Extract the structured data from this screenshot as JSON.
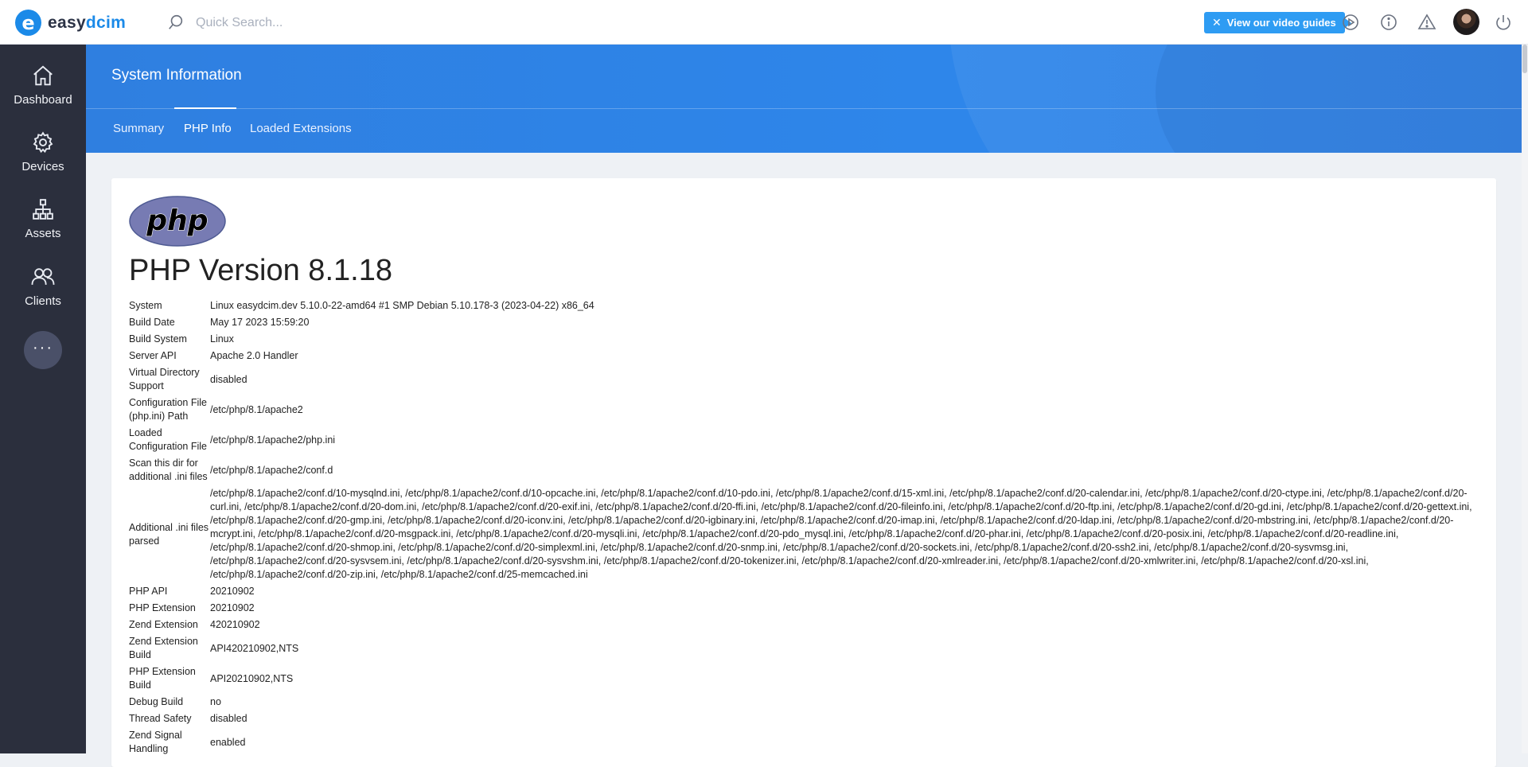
{
  "topbar": {
    "logo_letter": "e",
    "logo_text_a": "easy",
    "logo_text_b": "dcim",
    "search_placeholder": "Quick Search...",
    "video_button_label": "View our video guides",
    "icons": [
      "search-icon",
      "play-icon",
      "info-icon",
      "warning-icon",
      "avatar",
      "power-icon"
    ]
  },
  "sidebar": {
    "items": [
      {
        "label": "Dashboard",
        "icon": "home-icon"
      },
      {
        "label": "Devices",
        "icon": "gear-icon"
      },
      {
        "label": "Assets",
        "icon": "hierarchy-icon"
      },
      {
        "label": "Clients",
        "icon": "users-icon"
      }
    ],
    "more_label": "···"
  },
  "header": {
    "title": "System Information",
    "tabs": [
      {
        "label": "Summary",
        "active": false
      },
      {
        "label": "PHP Info",
        "active": true
      },
      {
        "label": "Loaded Extensions",
        "active": false
      }
    ]
  },
  "phpinfo": {
    "logo_text": "php",
    "version_title": "PHP Version 8.1.18",
    "rows": [
      {
        "key": "System",
        "value": "Linux easydcim.dev 5.10.0-22-amd64 #1 SMP Debian 5.10.178-3 (2023-04-22) x86_64"
      },
      {
        "key": "Build Date",
        "value": "May 17 2023 15:59:20"
      },
      {
        "key": "Build System",
        "value": "Linux"
      },
      {
        "key": "Server API",
        "value": "Apache 2.0 Handler"
      },
      {
        "key": "Virtual Directory Support",
        "value": "disabled"
      },
      {
        "key": "Configuration File (php.ini) Path",
        "value": "/etc/php/8.1/apache2"
      },
      {
        "key": "Loaded Configuration File",
        "value": "/etc/php/8.1/apache2/php.ini"
      },
      {
        "key": "Scan this dir for additional .ini files",
        "value": "/etc/php/8.1/apache2/conf.d"
      },
      {
        "key": "Additional .ini files parsed",
        "value": "/etc/php/8.1/apache2/conf.d/10-mysqlnd.ini, /etc/php/8.1/apache2/conf.d/10-opcache.ini, /etc/php/8.1/apache2/conf.d/10-pdo.ini, /etc/php/8.1/apache2/conf.d/15-xml.ini, /etc/php/8.1/apache2/conf.d/20-calendar.ini, /etc/php/8.1/apache2/conf.d/20-ctype.ini, /etc/php/8.1/apache2/conf.d/20-curl.ini, /etc/php/8.1/apache2/conf.d/20-dom.ini, /etc/php/8.1/apache2/conf.d/20-exif.ini, /etc/php/8.1/apache2/conf.d/20-ffi.ini, /etc/php/8.1/apache2/conf.d/20-fileinfo.ini, /etc/php/8.1/apache2/conf.d/20-ftp.ini, /etc/php/8.1/apache2/conf.d/20-gd.ini, /etc/php/8.1/apache2/conf.d/20-gettext.ini, /etc/php/8.1/apache2/conf.d/20-gmp.ini, /etc/php/8.1/apache2/conf.d/20-iconv.ini, /etc/php/8.1/apache2/conf.d/20-igbinary.ini, /etc/php/8.1/apache2/conf.d/20-imap.ini, /etc/php/8.1/apache2/conf.d/20-ldap.ini, /etc/php/8.1/apache2/conf.d/20-mbstring.ini, /etc/php/8.1/apache2/conf.d/20-mcrypt.ini, /etc/php/8.1/apache2/conf.d/20-msgpack.ini, /etc/php/8.1/apache2/conf.d/20-mysqli.ini, /etc/php/8.1/apache2/conf.d/20-pdo_mysql.ini, /etc/php/8.1/apache2/conf.d/20-phar.ini, /etc/php/8.1/apache2/conf.d/20-posix.ini, /etc/php/8.1/apache2/conf.d/20-readline.ini, /etc/php/8.1/apache2/conf.d/20-shmop.ini, /etc/php/8.1/apache2/conf.d/20-simplexml.ini, /etc/php/8.1/apache2/conf.d/20-snmp.ini, /etc/php/8.1/apache2/conf.d/20-sockets.ini, /etc/php/8.1/apache2/conf.d/20-ssh2.ini, /etc/php/8.1/apache2/conf.d/20-sysvmsg.ini, /etc/php/8.1/apache2/conf.d/20-sysvsem.ini, /etc/php/8.1/apache2/conf.d/20-sysvshm.ini, /etc/php/8.1/apache2/conf.d/20-tokenizer.ini, /etc/php/8.1/apache2/conf.d/20-xmlreader.ini, /etc/php/8.1/apache2/conf.d/20-xmlwriter.ini, /etc/php/8.1/apache2/conf.d/20-xsl.ini, /etc/php/8.1/apache2/conf.d/20-zip.ini, /etc/php/8.1/apache2/conf.d/25-memcached.ini"
      },
      {
        "key": "PHP API",
        "value": "20210902"
      },
      {
        "key": "PHP Extension",
        "value": "20210902"
      },
      {
        "key": "Zend Extension",
        "value": "420210902"
      },
      {
        "key": "Zend Extension Build",
        "value": "API420210902,NTS"
      },
      {
        "key": "PHP Extension Build",
        "value": "API20210902,NTS"
      },
      {
        "key": "Debug Build",
        "value": "no"
      },
      {
        "key": "Thread Safety",
        "value": "disabled"
      },
      {
        "key": "Zend Signal Handling",
        "value": "enabled"
      }
    ]
  },
  "colors": {
    "brand_blue": "#1b8ae8",
    "banner_blue": "#2e86ea",
    "sidebar_bg": "#2b2f3d",
    "video_button": "#2e9cf3"
  }
}
